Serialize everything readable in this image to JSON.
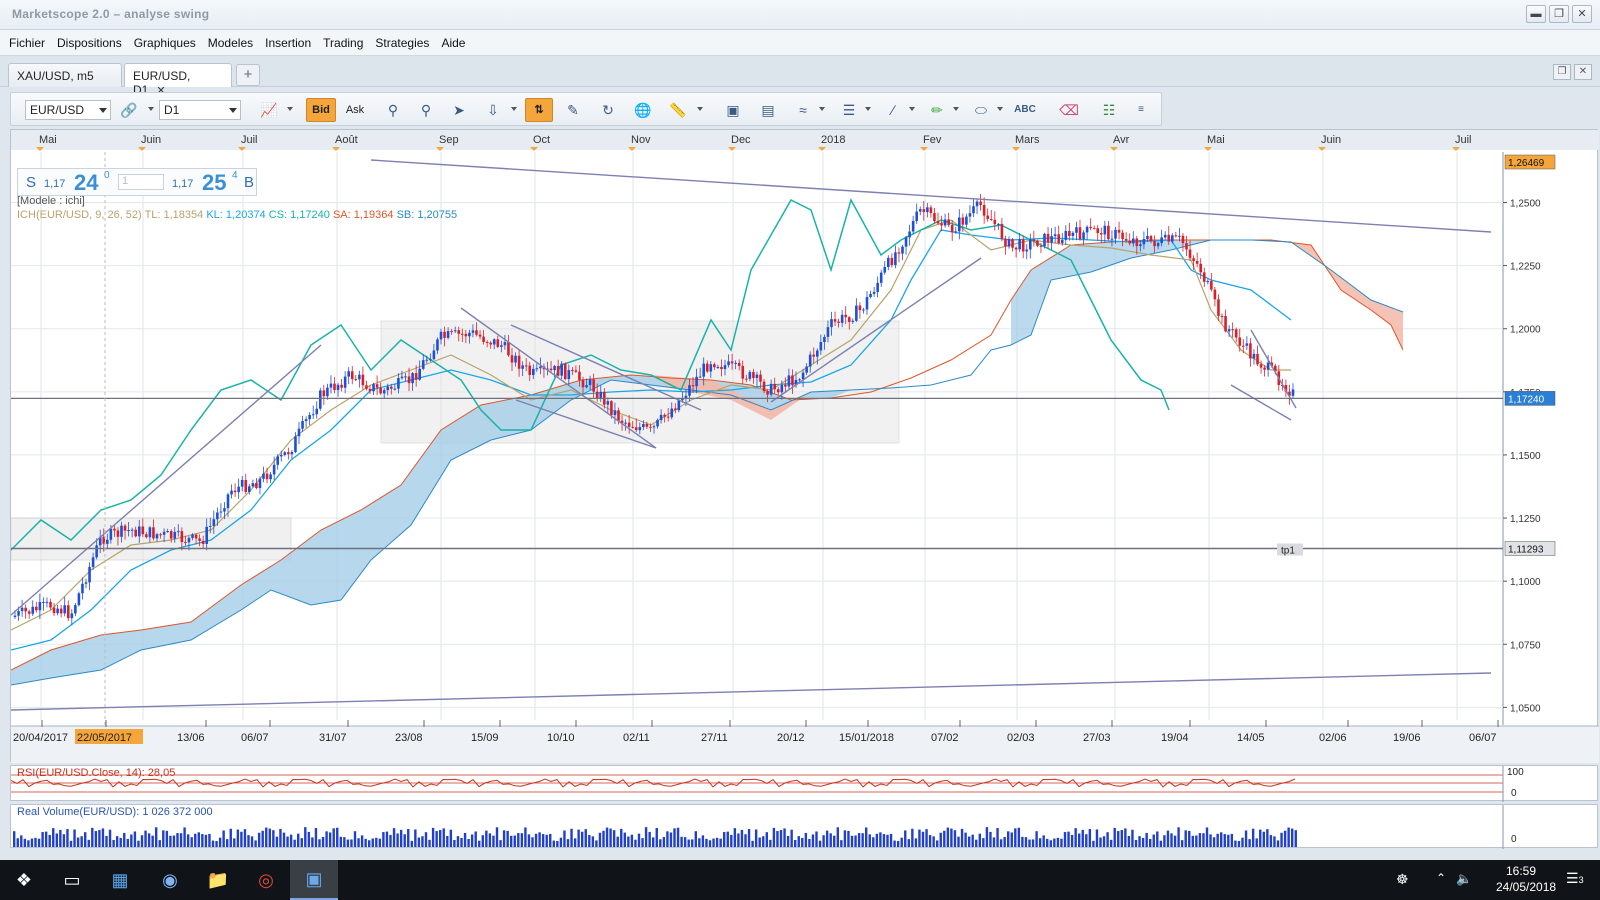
{
  "window": {
    "title": "Marketscope 2.0 – analyse swing",
    "controls": [
      "minimize",
      "restore",
      "close"
    ]
  },
  "menu": [
    "Fichier",
    "Dispositions",
    "Graphiques",
    "Modeles",
    "Insertion",
    "Trading",
    "Strategies",
    "Aide"
  ],
  "tabs": [
    {
      "label": "XAU/USD, m5",
      "active": false
    },
    {
      "label": "EUR/USD, D1",
      "active": true,
      "close": "✕"
    }
  ],
  "tab_add": "+",
  "toolbar": {
    "instrument": "EUR/USD",
    "timeframe": "D1",
    "bid_label": "Bid",
    "ask_label": "Ask",
    "icons": [
      "chart-type-icon",
      "link-icon",
      "crosshair-icon",
      "zoom-in-icon",
      "zoom-out-icon",
      "cursor-icon",
      "scale-icon",
      "autoscroll-icon",
      "properties-icon",
      "rotate-icon",
      "globe-icon",
      "ruler-icon",
      "image-icon",
      "template-icon",
      "fibonacci-icon",
      "lines-icon",
      "trendline-icon",
      "pen-icon",
      "ellipse-icon",
      "text-icon",
      "eraser-icon",
      "tree-icon",
      "more-icon"
    ]
  },
  "chart": {
    "price_panel": {
      "s_label": "S",
      "bid_prefix": "1,17",
      "bid_big": "24",
      "bid_sup": "0",
      "amount": "1",
      "ask_prefix": "1,17",
      "ask_big": "25",
      "ask_sup": "4",
      "b_label": "B"
    },
    "model_label": "[Modele : ichi]",
    "ichimoku": {
      "name": "ICH(EUR/USD, 9, 26, 52)",
      "tl": "TL: 1,18354",
      "kl": "KL: 1,20374",
      "cs": "CS: 1,17240",
      "sa": "SA: 1,19364",
      "sb": "SB: 1,20755",
      "colors": {
        "tl": "#b7a36a",
        "kl": "#1aa6e6",
        "cs": "#19b2a8",
        "sa": "#e0552a",
        "sb": "#2a8ac8"
      }
    },
    "months": [
      "Mai",
      "Juin",
      "Juil",
      "Août",
      "Sep",
      "Oct",
      "Nov",
      "Dec",
      "2018",
      "Fev",
      "Mars",
      "Avr",
      "Mai",
      "Juin",
      "Juil"
    ],
    "y_ticks": [
      "1,2500",
      "1,2250",
      "1,2000",
      "1,1750",
      "1,1500",
      "1,1250",
      "1,1000",
      "1,0750",
      "1,0500"
    ],
    "x_dates": [
      "20/04/2017",
      "22/05/2017",
      "13/06",
      "06/07",
      "31/07",
      "23/08",
      "15/09",
      "10/10",
      "02/11",
      "27/11",
      "20/12",
      "15/01/2018",
      "07/02",
      "02/03",
      "27/03",
      "19/04",
      "14/05",
      "02/06",
      "19/06",
      "06/07"
    ],
    "price_labels": {
      "high": "1,26469",
      "current": "1,17240",
      "tp1": "1,11293"
    },
    "tp1_label": "tp1",
    "colors": {
      "up_candle": "#1f4fd6",
      "down_candle": "#d8202a",
      "cloud_bull": "#9fcbe6",
      "cloud_bear": "#f3b8a8",
      "trendline": "#7d80b0",
      "accent": "#f5a63b"
    }
  },
  "chart_data": {
    "type": "candlestick",
    "instrument": "EUR/USD",
    "timeframe": "D1",
    "ylim": [
      1.045,
      1.27
    ],
    "horizontal_levels": [
      1.1724,
      1.11293
    ],
    "series": [
      {
        "name": "EUR/USD",
        "x": [
          "20/04/2017",
          "22/05/2017",
          "13/06",
          "06/07",
          "31/07",
          "23/08",
          "15/09",
          "10/10",
          "02/11",
          "27/11",
          "20/12",
          "15/01/2018",
          "07/02",
          "02/03",
          "27/03",
          "19/04",
          "14/05"
        ],
        "values": [
          1.085,
          1.112,
          1.121,
          1.139,
          1.18,
          1.182,
          1.198,
          1.178,
          1.165,
          1.19,
          1.183,
          1.219,
          1.233,
          1.232,
          1.236,
          1.233,
          1.182
        ]
      },
      {
        "name": "CS",
        "x": [
          "20/04/2017",
          "22/05/2017",
          "13/06",
          "06/07",
          "31/07",
          "23/08",
          "15/09",
          "10/10",
          "02/11",
          "27/11",
          "20/12",
          "15/01/2018",
          "07/02",
          "02/03",
          "27/03",
          "19/04"
        ],
        "values": [
          1.12,
          1.136,
          1.158,
          1.17,
          1.199,
          1.189,
          1.182,
          1.172,
          1.183,
          1.21,
          1.25,
          1.228,
          1.245,
          1.235,
          1.2,
          1.172
        ]
      }
    ]
  },
  "rsi": {
    "label": "RSI(EUR/USD.Close, 14): 28,05",
    "scale_top": "100",
    "scale_bottom": "0"
  },
  "volume": {
    "label": "Real Volume(EUR/USD): 1 026 372 000",
    "scale_bottom": "0"
  },
  "taskbar": {
    "apps": [
      "windows-start-icon",
      "task-view-icon",
      "store-icon",
      "browser-icon",
      "folder-icon",
      "chrome-icon",
      "marketscope-icon"
    ],
    "time": "16:59",
    "date": "24/05/2018",
    "notifications": "3"
  }
}
